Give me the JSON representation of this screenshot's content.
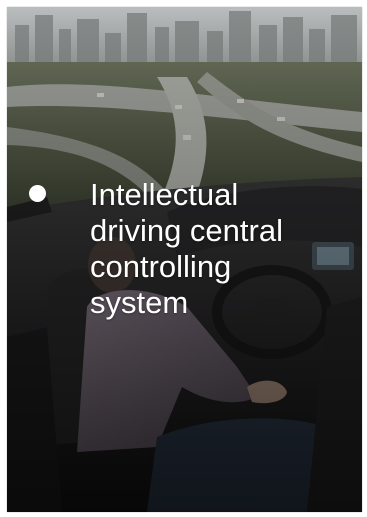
{
  "slide": {
    "feature_text": "Intellectual driving central controlling system",
    "bullet_icon": "bullet-dot-icon",
    "text_color": "#ffffff",
    "background_scene": "autonomous car cockpit over highway interchange"
  }
}
